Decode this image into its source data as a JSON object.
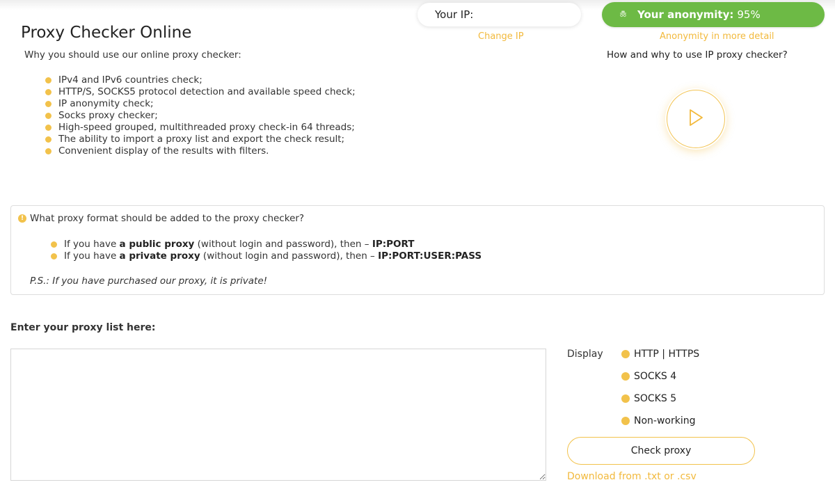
{
  "header": {
    "ip_label": "Your IP:",
    "change_ip": "Change IP",
    "anonymity_label": "Your anonymity:",
    "anonymity_value": "95%",
    "anonymity_detail": "Anonymity in more detail"
  },
  "main": {
    "title": "Proxy Checker Online",
    "subtitle": "Why you should use our online proxy checker:",
    "features": [
      "IPv4 and IPv6 countries check;",
      "HTTP/S, SOCKS5 protocol detection and available speed check;",
      "IP anonymity check;",
      "Socks proxy checker;",
      "High-speed grouped, multithreaded proxy check-in 64 threads;",
      "The ability to import a proxy list and export the check result;",
      "Convenient display of the results with filters."
    ],
    "video_heading": "How and why to use IP proxy checker?"
  },
  "info": {
    "question": "What proxy format should be added to the proxy checker?",
    "public": {
      "pre": "If you have ",
      "strong": "a public proxy",
      "post": " (without login and password), then – ",
      "format": "IP:PORT"
    },
    "private": {
      "pre": "If you have ",
      "strong": "a private proxy",
      "post": " (without login and password), then – ",
      "format": "IP:PORT:USER:PASS"
    },
    "ps": "P.S.: If you have purchased our proxy, it is private!"
  },
  "checker": {
    "input_label": "Enter your proxy list here:",
    "textarea_value": "",
    "display_label": "Display",
    "filters": [
      "HTTP | HTTPS",
      "SOCKS 4",
      "SOCKS 5",
      "Non-working"
    ],
    "check_button": "Check proxy",
    "download_link": "Download from .txt or .csv"
  },
  "colors": {
    "accent": "#f2c24b",
    "link": "#f2b93c",
    "anonymity_green": "#6dba45"
  },
  "icons": [
    "spy-icon",
    "play-icon",
    "warning-icon"
  ]
}
